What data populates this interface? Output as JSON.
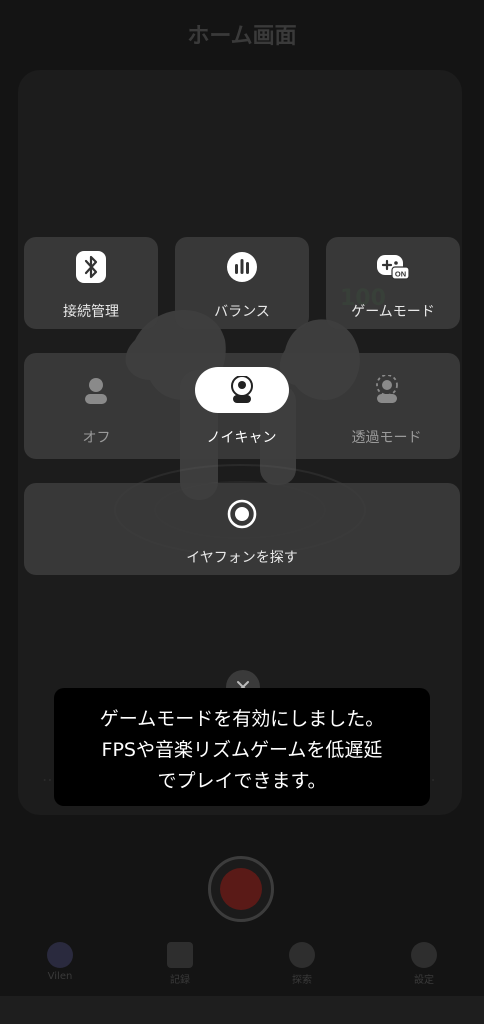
{
  "background": {
    "title": "ホーム画面",
    "battery": "100",
    "nav": [
      "Vilen",
      "記録",
      "探索",
      "設定"
    ]
  },
  "panel": {
    "connection_label": "接続管理",
    "balance_label": "バランス",
    "game_mode_label": "ゲームモード",
    "game_mode_badge": "ON",
    "nc_off_label": "オフ",
    "nc_on_label": "ノイキャン",
    "transparent_label": "透過モード",
    "find_label": "イヤフォンを探す"
  },
  "toast": {
    "lines": [
      "ゲームモードを有効にしました。",
      "FPSや音楽リズムゲームを低遅延",
      "でプレイできます。"
    ]
  },
  "colors": {
    "tile_bg": "#3e3e3e",
    "toast_bg": "#000000",
    "pill_bg": "#ffffff",
    "record_red": "#5a1a17"
  }
}
